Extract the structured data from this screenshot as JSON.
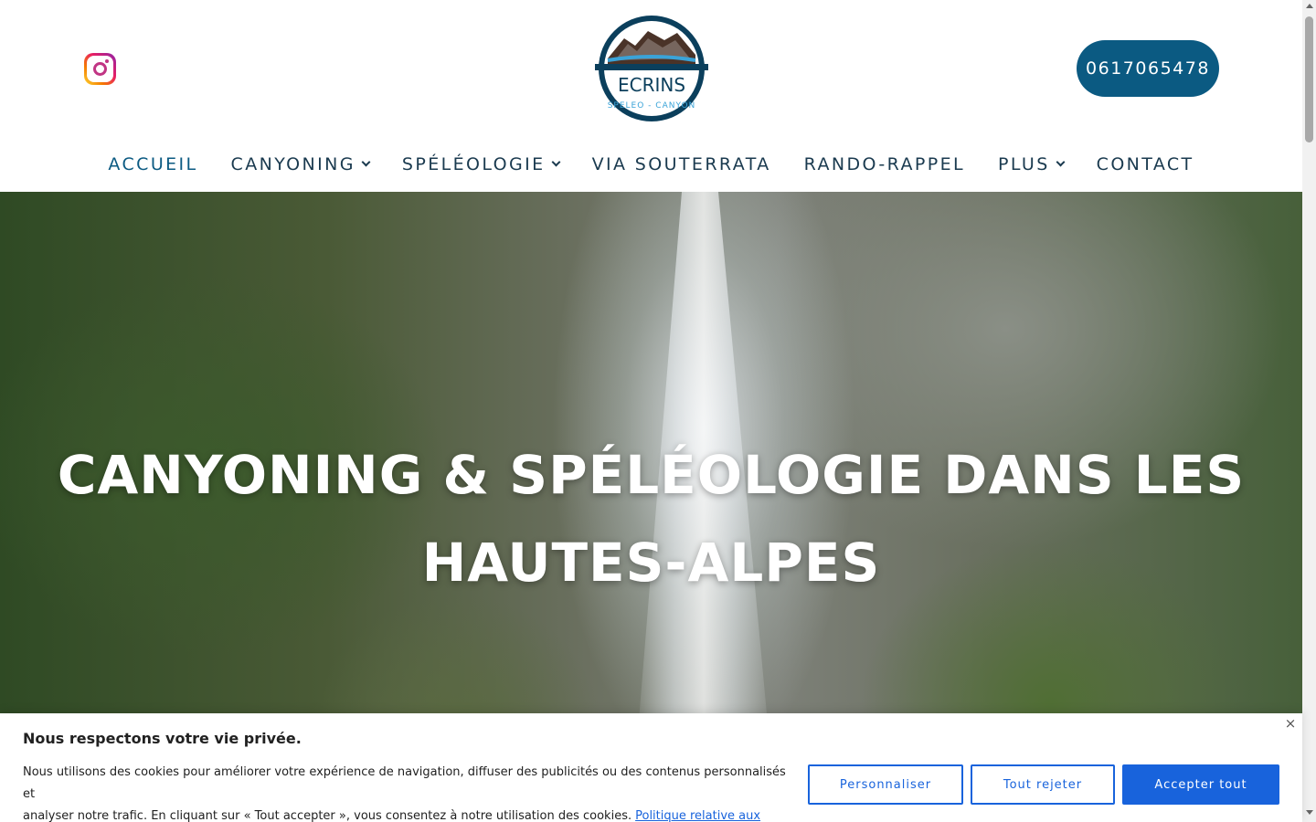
{
  "header": {
    "logo": {
      "wordmark": "ECRINS",
      "subtitle": "SPELEO - CANYON"
    },
    "phone": "0617065478",
    "social": {
      "icon": "instagram-icon"
    }
  },
  "nav": {
    "items": [
      {
        "label": "ACCUEIL",
        "active": true,
        "has_dropdown": false
      },
      {
        "label": "CANYONING",
        "active": false,
        "has_dropdown": true
      },
      {
        "label": "SPÉLÉOLOGIE",
        "active": false,
        "has_dropdown": true
      },
      {
        "label": "VIA SOUTERRATA",
        "active": false,
        "has_dropdown": false
      },
      {
        "label": "RANDO-RAPPEL",
        "active": false,
        "has_dropdown": false
      },
      {
        "label": "PLUS",
        "active": false,
        "has_dropdown": true
      },
      {
        "label": "CONTACT",
        "active": false,
        "has_dropdown": false
      }
    ]
  },
  "hero": {
    "title_line1": "CANYONING & SPÉLÉOLOGIE DANS LES",
    "title_line2": "HAUTES-ALPES"
  },
  "cookie_banner": {
    "title": "Nous respectons votre vie privée.",
    "text_line1": "Nous utilisons des cookies pour améliorer votre expérience de navigation, diffuser des publicités ou des contenus personnalisés et",
    "text_line2": "analyser notre trafic. En cliquant sur « Tout accepter », vous consentez à notre utilisation des cookies.",
    "policy_link": "Politique relative aux cookies",
    "close_glyph": "×",
    "buttons": {
      "customize": "Personnaliser",
      "reject": "Tout rejeter",
      "accept": "Accepter tout"
    }
  },
  "colors": {
    "brand_blue": "#0b5a82",
    "nav_text": "#1a3a4f",
    "cookie_accent": "#1863dc"
  }
}
